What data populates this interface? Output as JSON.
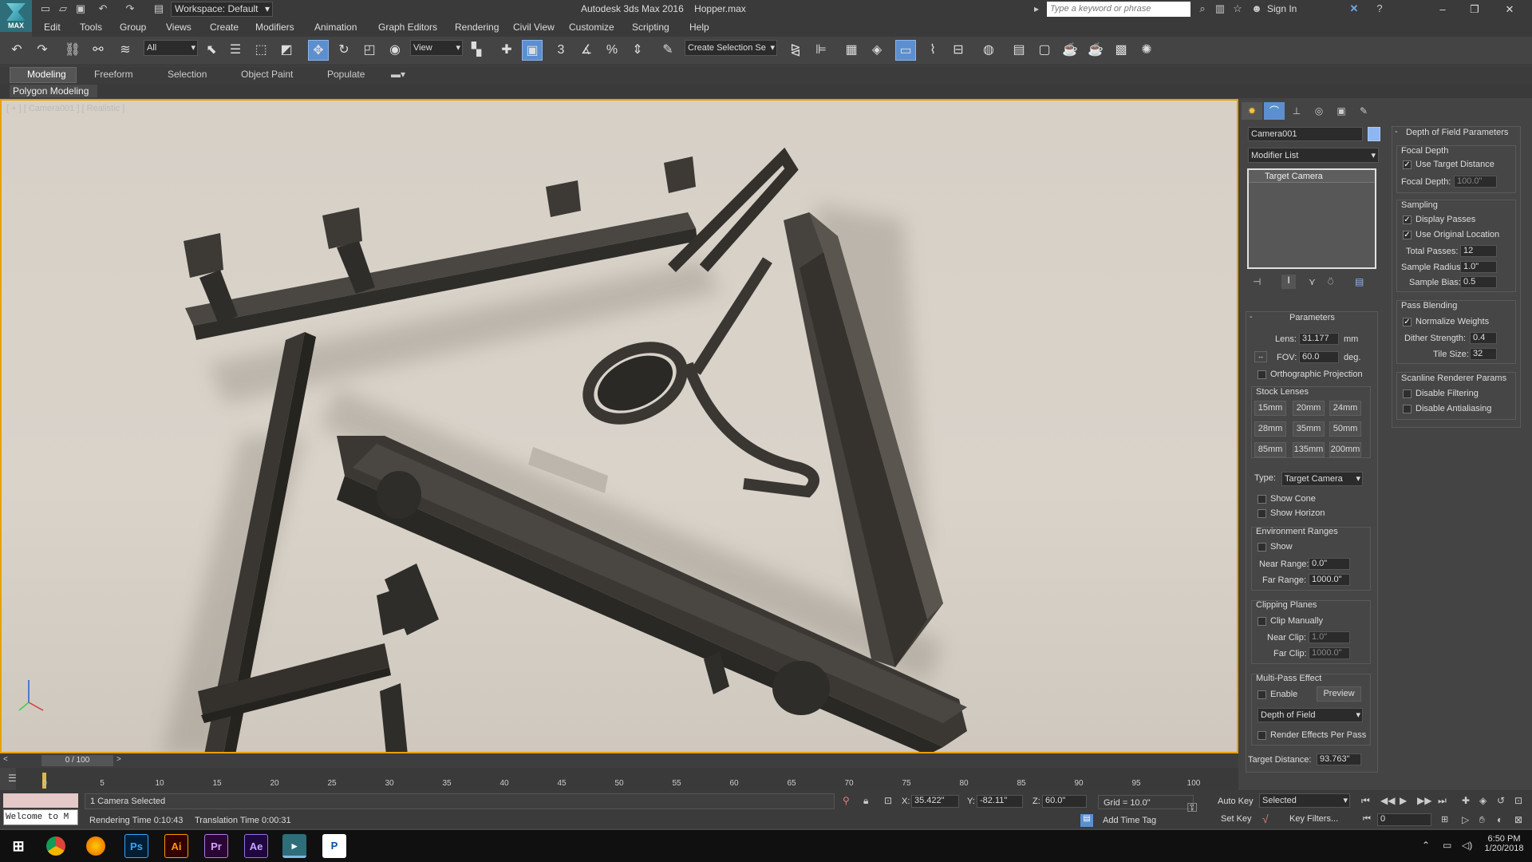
{
  "title_bar": {
    "workspace": "Workspace: Default",
    "app_title": "Autodesk 3ds Max 2016",
    "file_name": "Hopper.max",
    "search_placeholder": "Type a keyword or phrase",
    "sign_in": "Sign In",
    "app_icon_text": "MAX"
  },
  "menu": [
    "Edit",
    "Tools",
    "Group",
    "Views",
    "Create",
    "Modifiers",
    "Animation",
    "Graph Editors",
    "Rendering",
    "Civil View",
    "Customize",
    "Scripting",
    "Help"
  ],
  "toolbar": {
    "selection_filter": "All",
    "ref_coord": "View",
    "selection_set": "Create Selection Se",
    "snap_3": "3",
    "snap_percent": "%"
  },
  "ribbon": {
    "tabs": [
      "Modeling",
      "Freeform",
      "Selection",
      "Object Paint",
      "Populate"
    ],
    "active_panel": "Polygon Modeling"
  },
  "viewport": {
    "label": "[ + ] [ Camera001 ] [ Realistic ]"
  },
  "command_panel": {
    "object_name": "Camera001",
    "modifier_list": "Modifier List",
    "stack_item": "Target Camera",
    "parameters": {
      "title": "Parameters",
      "lens_label": "Lens:",
      "lens_value": "31.177",
      "lens_unit": "mm",
      "fov_label": "FOV:",
      "fov_value": "60.0",
      "fov_unit": "deg.",
      "ortho": "Orthographic Projection",
      "stock_lenses_title": "Stock Lenses",
      "stock_lenses": [
        "15mm",
        "20mm",
        "24mm",
        "28mm",
        "35mm",
        "50mm",
        "85mm",
        "135mm",
        "200mm"
      ],
      "type_label": "Type:",
      "type_value": "Target Camera",
      "show_cone": "Show Cone",
      "show_horizon": "Show Horizon",
      "env_title": "Environment Ranges",
      "env_show": "Show",
      "near_range_label": "Near Range:",
      "near_range_value": "0.0\"",
      "far_range_label": "Far Range:",
      "far_range_value": "1000.0\"",
      "clip_title": "Clipping Planes",
      "clip_manually": "Clip Manually",
      "near_clip_label": "Near Clip:",
      "near_clip_value": "1.0\"",
      "far_clip_label": "Far Clip:",
      "far_clip_value": "1000.0\"",
      "multipass_title": "Multi-Pass Effect",
      "enable": "Enable",
      "preview": "Preview",
      "effect": "Depth of Field",
      "render_effects": "Render Effects Per Pass",
      "target_distance_label": "Target Distance:",
      "target_distance_value": "93.763\""
    },
    "dof": {
      "title": "Depth of Field Parameters",
      "focal_depth_title": "Focal Depth",
      "use_target_distance": "Use Target Distance",
      "focal_depth_label": "Focal Depth:",
      "focal_depth_value": "100.0\"",
      "sampling_title": "Sampling",
      "display_passes": "Display Passes",
      "use_original_location": "Use Original Location",
      "total_passes_label": "Total Passes:",
      "total_passes_value": "12",
      "sample_radius_label": "Sample Radius:",
      "sample_radius_value": "1.0\"",
      "sample_bias_label": "Sample Bias:",
      "sample_bias_value": "0.5",
      "pass_blending_title": "Pass Blending",
      "normalize_weights": "Normalize Weights",
      "dither_label": "Dither Strength:",
      "dither_value": "0.4",
      "tile_label": "Tile Size:",
      "tile_value": "32",
      "scanline_title": "Scanline Renderer Params",
      "disable_filtering": "Disable Filtering",
      "disable_antialiasing": "Disable Antialiasing"
    }
  },
  "timeline": {
    "frame": "0 / 100",
    "ticks": [
      "0",
      "5",
      "10",
      "15",
      "20",
      "25",
      "30",
      "35",
      "40",
      "45",
      "50",
      "55",
      "60",
      "65",
      "70",
      "75",
      "80",
      "85",
      "90",
      "95",
      "100"
    ]
  },
  "status": {
    "maxscript": "Welcome to M",
    "selected": "1 Camera Selected",
    "rendering_time": "Rendering Time  0:10:43",
    "translation_time": "Translation Time  0:00:31",
    "x_label": "X:",
    "x_value": "35.422\"",
    "y_label": "Y:",
    "y_value": "-82.11\"",
    "z_label": "Z:",
    "z_value": "60.0\"",
    "grid": "Grid = 10.0\"",
    "add_time_tag": "Add Time Tag",
    "auto_key": "Auto Key",
    "key_mode": "Selected",
    "set_key": "Set Key",
    "key_filters": "Key Filters...",
    "current_frame": "0"
  },
  "taskbar": {
    "apps": [
      "Ps",
      "Ai",
      "Pr",
      "Ae"
    ],
    "time": "6:50 PM",
    "date": "1/20/2018"
  }
}
